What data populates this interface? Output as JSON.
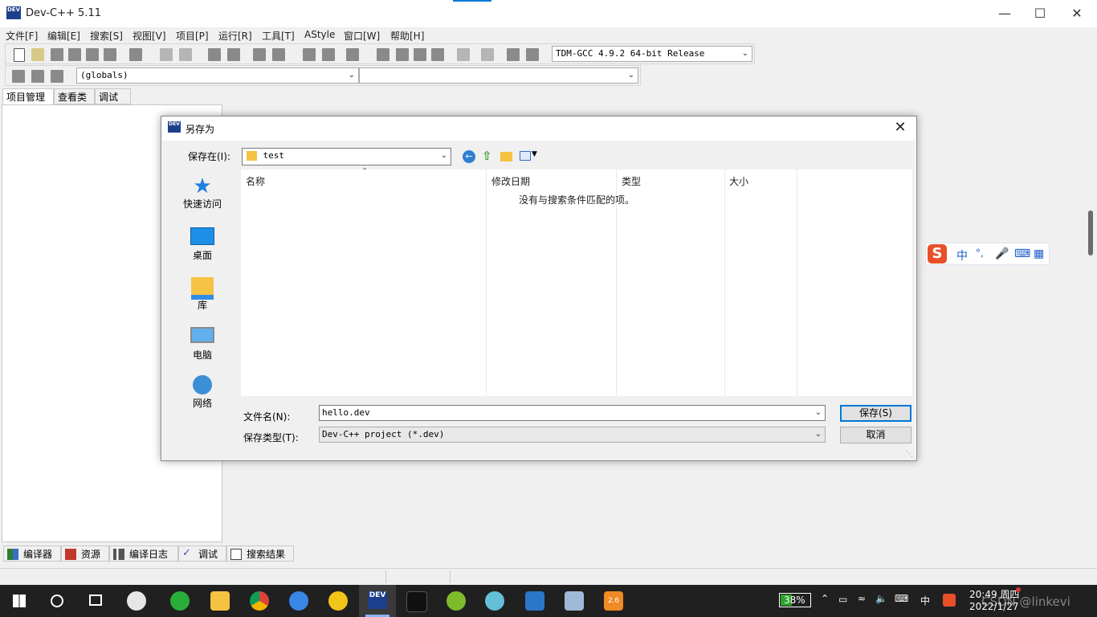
{
  "window": {
    "title": "Dev-C++ 5.11",
    "app_icon_text": "DEV"
  },
  "menu": [
    "文件[F]",
    "编辑[E]",
    "搜索[S]",
    "视图[V]",
    "项目[P]",
    "运行[R]",
    "工具[T]",
    "AStyle",
    "窗口[W]",
    "帮助[H]"
  ],
  "toolbar": {
    "compiler": "TDM-GCC 4.9.2 64-bit Release",
    "scope": "(globals)",
    "member": ""
  },
  "left_tabs": [
    "项目管理",
    "查看类",
    "调试"
  ],
  "bottom_tabs": [
    "编译器",
    "资源",
    "编译日志",
    "调试",
    "搜索结果"
  ],
  "dialog": {
    "title": "另存为",
    "save_in_label": "保存在(I):",
    "save_in_value": "test",
    "places": [
      "快速访问",
      "桌面",
      "库",
      "电脑",
      "网络"
    ],
    "columns": [
      "名称",
      "修改日期",
      "类型",
      "大小"
    ],
    "empty_message": "没有与搜索条件匹配的项。",
    "filename_label": "文件名(N):",
    "filename_value": "hello.dev",
    "filetype_label": "保存类型(T):",
    "filetype_value": "Dev-C++ project (*.dev)",
    "save_button": "保存(S)",
    "cancel_button": "取消"
  },
  "ime": {
    "lang": "中",
    "punct": "°,",
    "brand_letter": "S"
  },
  "taskbar": {
    "battery": "38%",
    "lang": "中",
    "time": "20:49 周四",
    "date": "2022/1/27",
    "watermark": "CSDN @linkevi",
    "badge": "2.6"
  },
  "colors": {
    "accent": "#0078d7",
    "taskbar": "#202020",
    "dev_icon": "#1b3f8b"
  }
}
